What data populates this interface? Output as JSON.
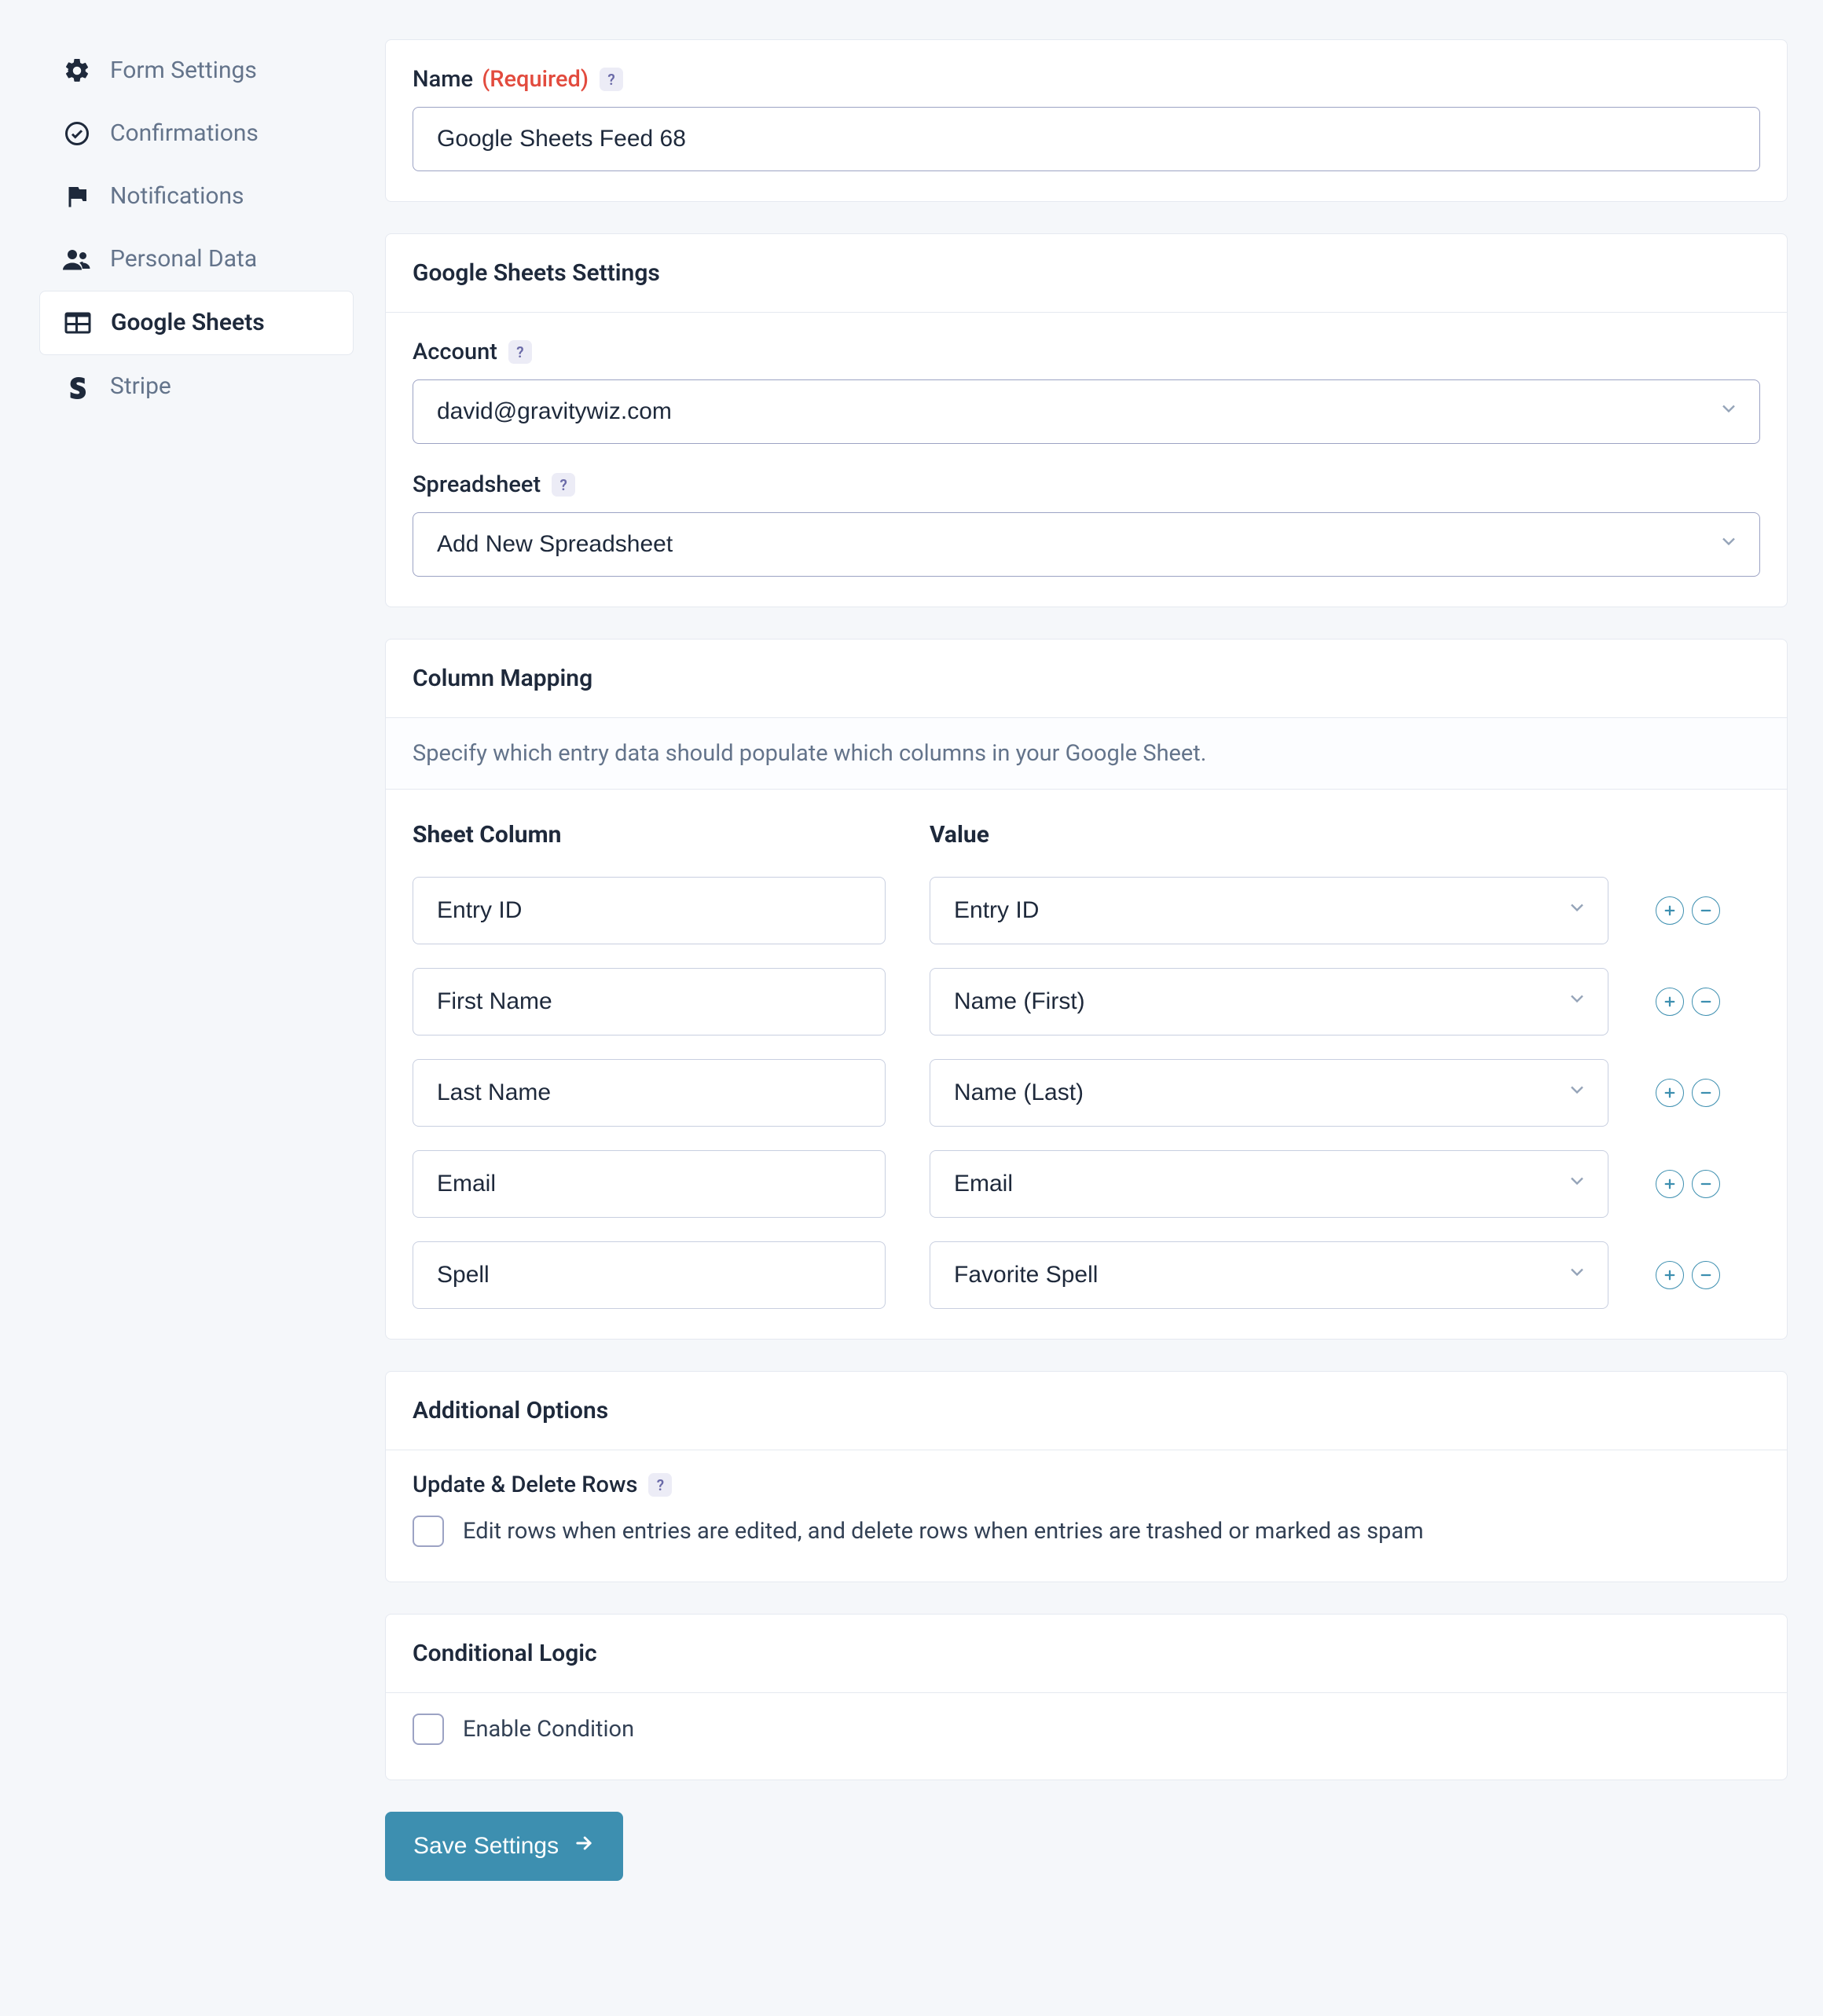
{
  "sidebar": {
    "items": [
      {
        "label": "Form Settings"
      },
      {
        "label": "Confirmations"
      },
      {
        "label": "Notifications"
      },
      {
        "label": "Personal Data"
      },
      {
        "label": "Google Sheets"
      },
      {
        "label": "Stripe"
      }
    ]
  },
  "namePanel": {
    "label": "Name",
    "requiredTag": "(Required)",
    "value": "Google Sheets Feed 68"
  },
  "settingsPanel": {
    "title": "Google Sheets Settings",
    "accountLabel": "Account",
    "accountValue": "david@gravitywiz.com",
    "spreadsheetLabel": "Spreadsheet",
    "spreadsheetValue": "Add New Spreadsheet"
  },
  "mappingPanel": {
    "title": "Column Mapping",
    "description": "Specify which entry data should populate which columns in your Google Sheet.",
    "colHeader1": "Sheet Column",
    "colHeader2": "Value",
    "rows": [
      {
        "column": "Entry ID",
        "value": "Entry ID"
      },
      {
        "column": "First Name",
        "value": "Name (First)"
      },
      {
        "column": "Last Name",
        "value": "Name (Last)"
      },
      {
        "column": "Email",
        "value": "Email"
      },
      {
        "column": "Spell",
        "value": "Favorite Spell"
      }
    ]
  },
  "additionalPanel": {
    "title": "Additional Options",
    "subLabel": "Update & Delete Rows",
    "checkboxLabel": "Edit rows when entries are edited, and delete rows when entries are trashed or marked as spam"
  },
  "conditionalPanel": {
    "title": "Conditional Logic",
    "checkboxLabel": "Enable Condition"
  },
  "saveButton": "Save Settings"
}
